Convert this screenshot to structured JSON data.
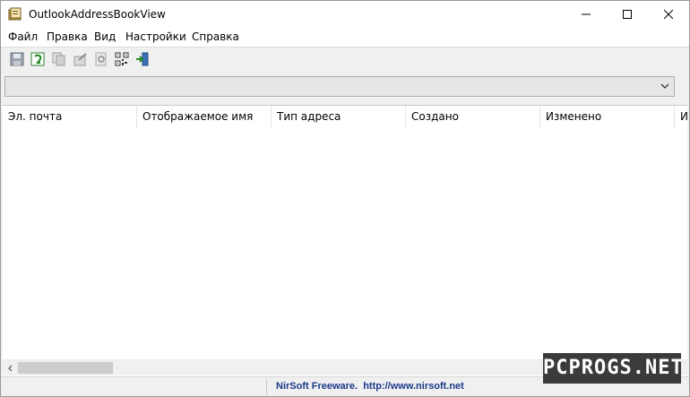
{
  "window": {
    "title": "OutlookAddressBookView"
  },
  "menubar": {
    "items": [
      "Файл",
      "Правка",
      "Вид",
      "Настройки",
      "Справка"
    ]
  },
  "toolbar": {
    "icons": [
      "save-icon",
      "refresh-icon",
      "copy-icon",
      "properties-icon",
      "report-icon",
      "qr-code-icon",
      "exit-icon"
    ]
  },
  "combo": {
    "value": ""
  },
  "table": {
    "columns": [
      "Эл. почта",
      "Отображаемое имя",
      "Тип адреса",
      "Создано",
      "Изменено",
      "И"
    ],
    "rows": []
  },
  "statusbar": {
    "link_text": "NirSoft Freeware.  http://www.nirsoft.net"
  },
  "watermark": {
    "text": "PCPROGS.NET"
  },
  "colors": {
    "link": "#1a3a8a",
    "accent": "#e6e6e6"
  }
}
